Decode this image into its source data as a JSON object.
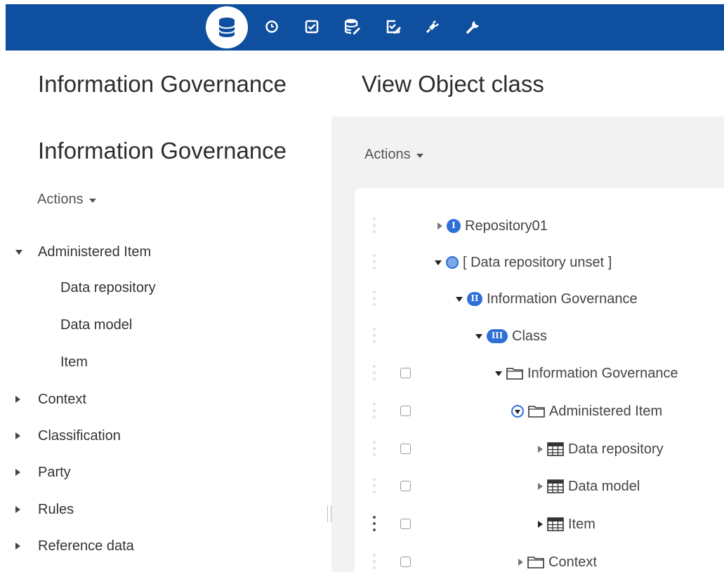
{
  "toolbar": {
    "icons": [
      "database-icon",
      "clock-icon",
      "checkbox-icon",
      "database-edit-icon",
      "checklist-edit-icon",
      "plug-icon",
      "wrench-icon"
    ],
    "active": "database-icon",
    "background": "#0f4fa0"
  },
  "left": {
    "title": "Information Governance",
    "subtitle": "Information Governance",
    "actions_label": "Actions",
    "items": [
      {
        "label": "Administered Item",
        "expanded": true
      },
      {
        "label": "Data repository"
      },
      {
        "label": "Data model"
      },
      {
        "label": "Item"
      },
      {
        "label": "Context",
        "expanded": false
      },
      {
        "label": "Classification",
        "expanded": false
      },
      {
        "label": "Party",
        "expanded": false
      },
      {
        "label": "Rules",
        "expanded": false
      },
      {
        "label": "Reference data",
        "expanded": false
      }
    ]
  },
  "right": {
    "title": "View Object class",
    "actions_label": "Actions",
    "tree": [
      {
        "label": "Repository01",
        "badge": "I"
      },
      {
        "label": "[ Data repository unset ]"
      },
      {
        "label": "Information Governance",
        "badge": "II"
      },
      {
        "label": "Class",
        "badge": "III"
      },
      {
        "label": "Information Governance"
      },
      {
        "label": "Administered Item"
      },
      {
        "label": "Data repository"
      },
      {
        "label": "Data model"
      },
      {
        "label": "Item"
      },
      {
        "label": "Context"
      }
    ]
  },
  "colors": {
    "accent": "#2e6fd8",
    "panel_bg": "#f2f2f2"
  }
}
